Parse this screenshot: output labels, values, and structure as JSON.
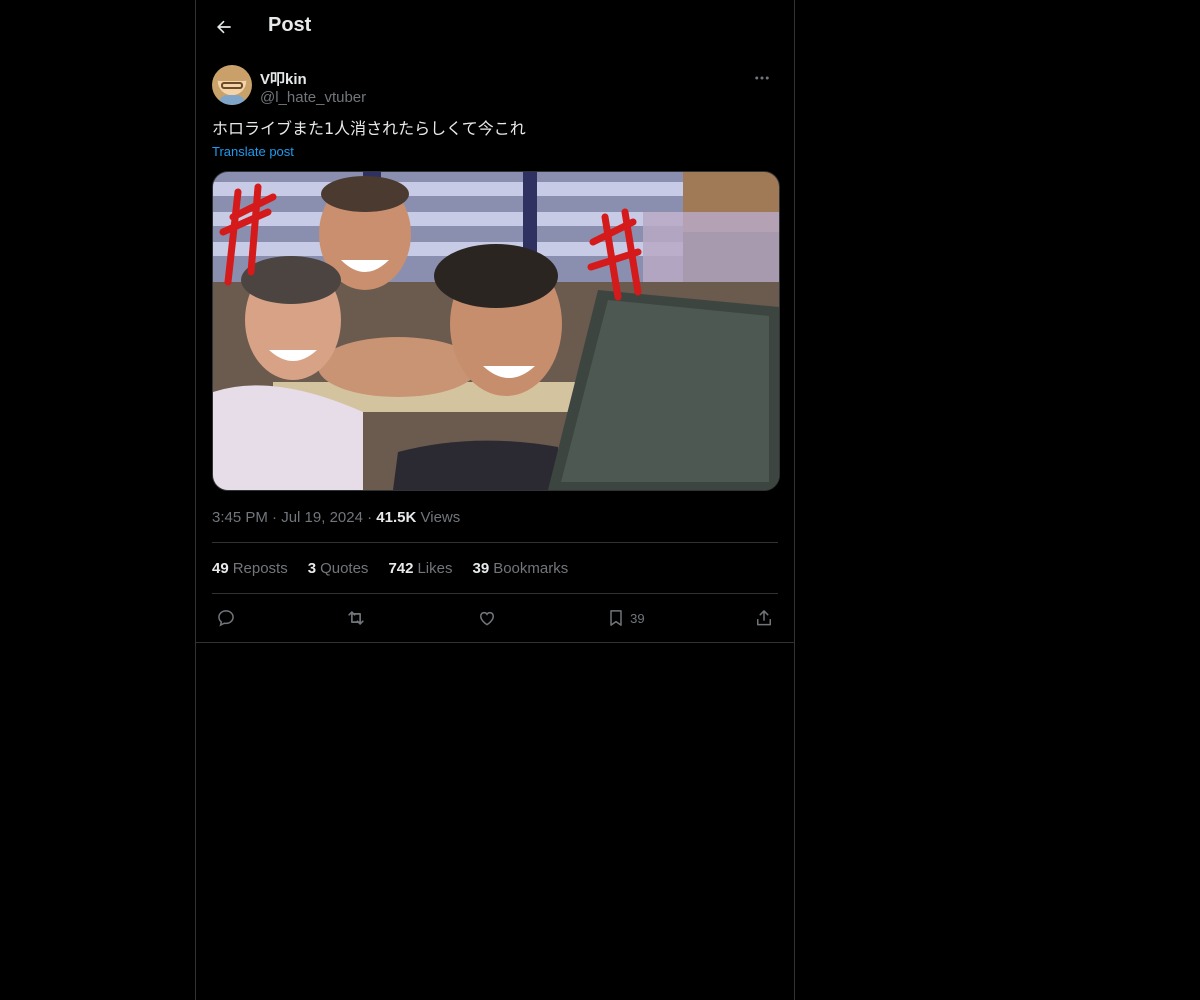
{
  "header": {
    "title": "Post"
  },
  "post": {
    "display_name": "V叩kin",
    "handle": "@l_hate_vtuber",
    "text": "ホロライブまた1人消されたらしくて今これ",
    "translate_label": "Translate post",
    "time": "3:45 PM",
    "date": "Jul 19, 2024",
    "views_count": "41.5K",
    "views_label": "Views",
    "stats": {
      "reposts_count": "49",
      "reposts_label": "Reposts",
      "quotes_count": "3",
      "quotes_label": "Quotes",
      "likes_count": "742",
      "likes_label": "Likes",
      "bookmarks_count": "39",
      "bookmarks_label": "Bookmarks"
    },
    "actions": {
      "bookmark_count": "39"
    },
    "icons": [
      "back-arrow-icon",
      "more-icon",
      "reply-icon",
      "repost-icon",
      "like-icon",
      "bookmark-icon",
      "share-icon"
    ]
  },
  "colors": {
    "background": "#000000",
    "text": "#e7e9ea",
    "muted": "#71767b",
    "accent": "#1d9bf0",
    "border": "#2f3336"
  }
}
